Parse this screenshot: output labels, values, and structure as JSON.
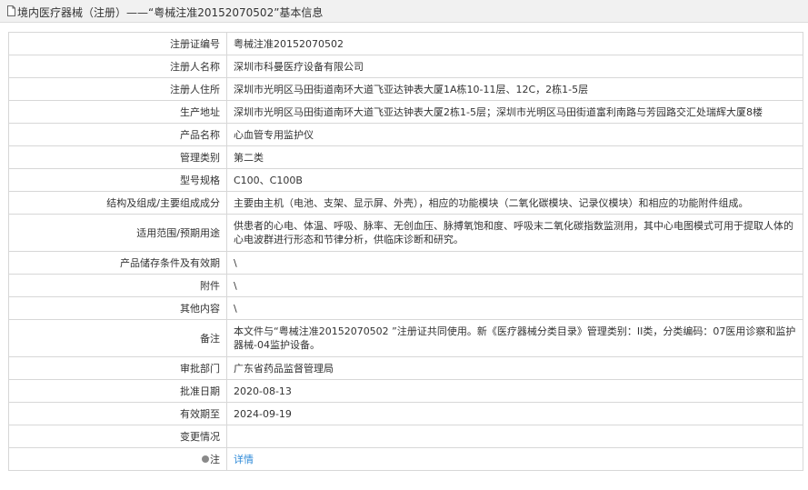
{
  "header": {
    "title": "境内医疗器械（注册）——“粤械注准20152070502”基本信息",
    "icon": "document-icon"
  },
  "rows": [
    {
      "label": "注册证编号",
      "value": "粤械注准20152070502"
    },
    {
      "label": "注册人名称",
      "value": "深圳市科曼医疗设备有限公司"
    },
    {
      "label": "注册人住所",
      "value": "深圳市光明区马田街道南环大道飞亚达钟表大厦1A栋10-11层、12C，2栋1-5层"
    },
    {
      "label": "生产地址",
      "value": "深圳市光明区马田街道南环大道飞亚达钟表大厦2栋1-5层；深圳市光明区马田街道富利南路与芳园路交汇处瑞辉大厦8楼"
    },
    {
      "label": "产品名称",
      "value": "心血管专用监护仪"
    },
    {
      "label": "管理类别",
      "value": "第二类"
    },
    {
      "label": "型号规格",
      "value": "C100、C100B"
    },
    {
      "label": "结构及组成/主要组成成分",
      "value": "主要由主机（电池、支架、显示屏、外壳），相应的功能模块（二氧化碳模块、记录仪模块）和相应的功能附件组成。"
    },
    {
      "label": "适用范围/预期用途",
      "value": "供患者的心电、体温、呼吸、脉率、无创血压、脉搏氧饱和度、呼吸末二氧化碳指数监测用，其中心电图模式可用于提取人体的心电波群进行形态和节律分析，供临床诊断和研究。"
    },
    {
      "label": "产品储存条件及有效期",
      "value": "\\"
    },
    {
      "label": "附件",
      "value": "\\"
    },
    {
      "label": "其他内容",
      "value": "\\"
    },
    {
      "label": "备注",
      "value": "本文件与“粤械注准20152070502 ”注册证共同使用。新《医疗器械分类目录》管理类别：II类，分类编码：07医用诊察和监护器械-04监护设备。"
    },
    {
      "label": "审批部门",
      "value": "广东省药品监督管理局"
    },
    {
      "label": "批准日期",
      "value": "2020-08-13"
    },
    {
      "label": "有效期至",
      "value": "2024-09-19"
    },
    {
      "label": "变更情况",
      "value": ""
    }
  ],
  "note_row": {
    "label": "注",
    "icon": "map-pin-icon",
    "link_label": "详情"
  },
  "colors": {
    "link": "#2e8ad8",
    "border": "#d7d7d7",
    "header_bg": "#f1f1f1"
  }
}
